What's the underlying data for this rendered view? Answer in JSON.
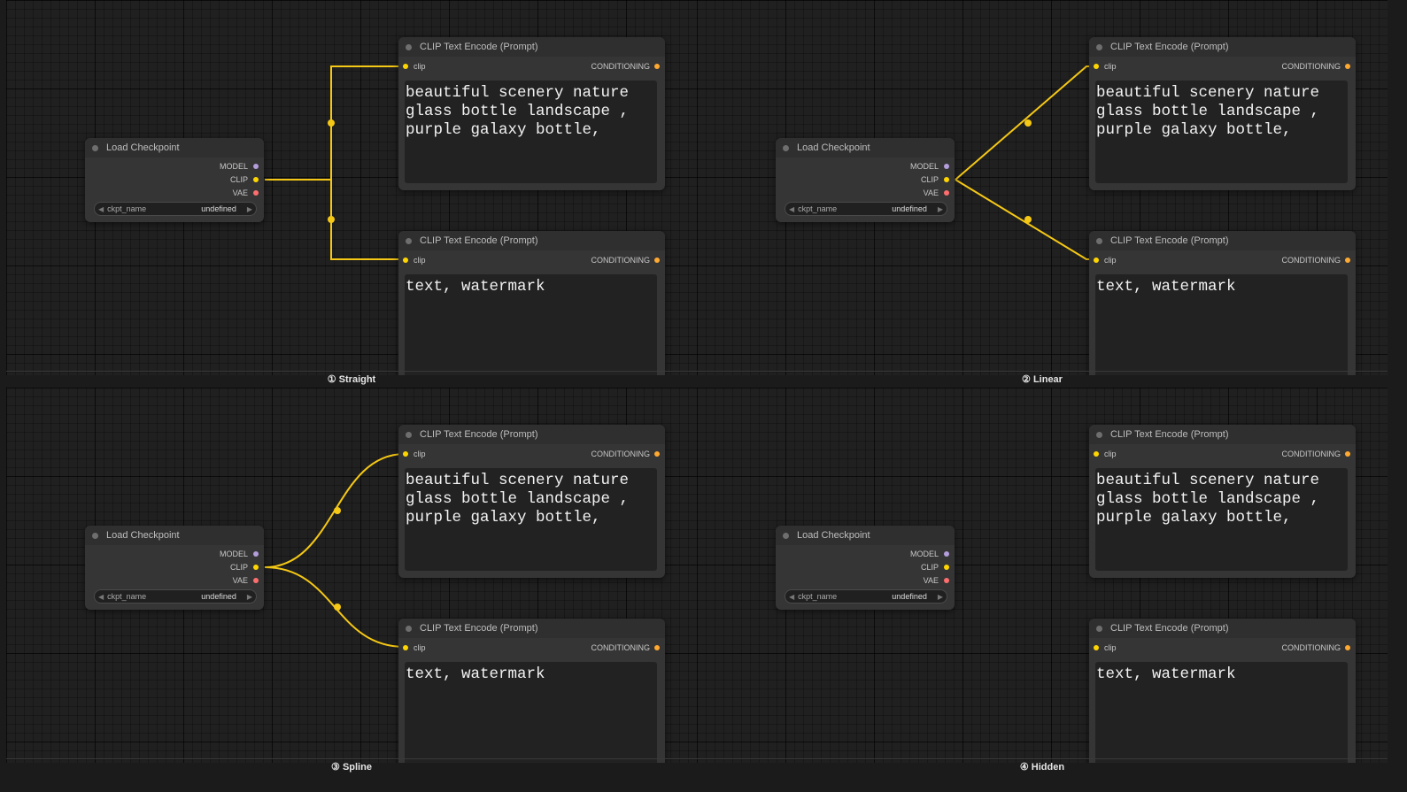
{
  "panels": [
    {
      "caption": "① Straight",
      "wire_style": "straight"
    },
    {
      "caption": "② Linear",
      "wire_style": "linear"
    },
    {
      "caption": "③ Spline",
      "wire_style": "spline"
    },
    {
      "caption": "④ Hidden",
      "wire_style": "hidden"
    }
  ],
  "checkpoint_node": {
    "title": "Load Checkpoint",
    "outputs": [
      "MODEL",
      "CLIP",
      "VAE"
    ],
    "widget_name": "ckpt_name",
    "widget_value": "undefined"
  },
  "clip_node": {
    "title": "CLIP Text Encode (Prompt)",
    "input": "clip",
    "output": "CONDITIONING"
  },
  "prompts": {
    "positive": "beautiful scenery nature\nglass bottle landscape ,\npurple galaxy bottle,",
    "negative": "text, watermark"
  },
  "colors": {
    "wire": "#f5c816",
    "model": "#b39ddb",
    "clip": "#ffd500",
    "vae": "#ff6e6e",
    "conditioning": "#ffa931"
  }
}
